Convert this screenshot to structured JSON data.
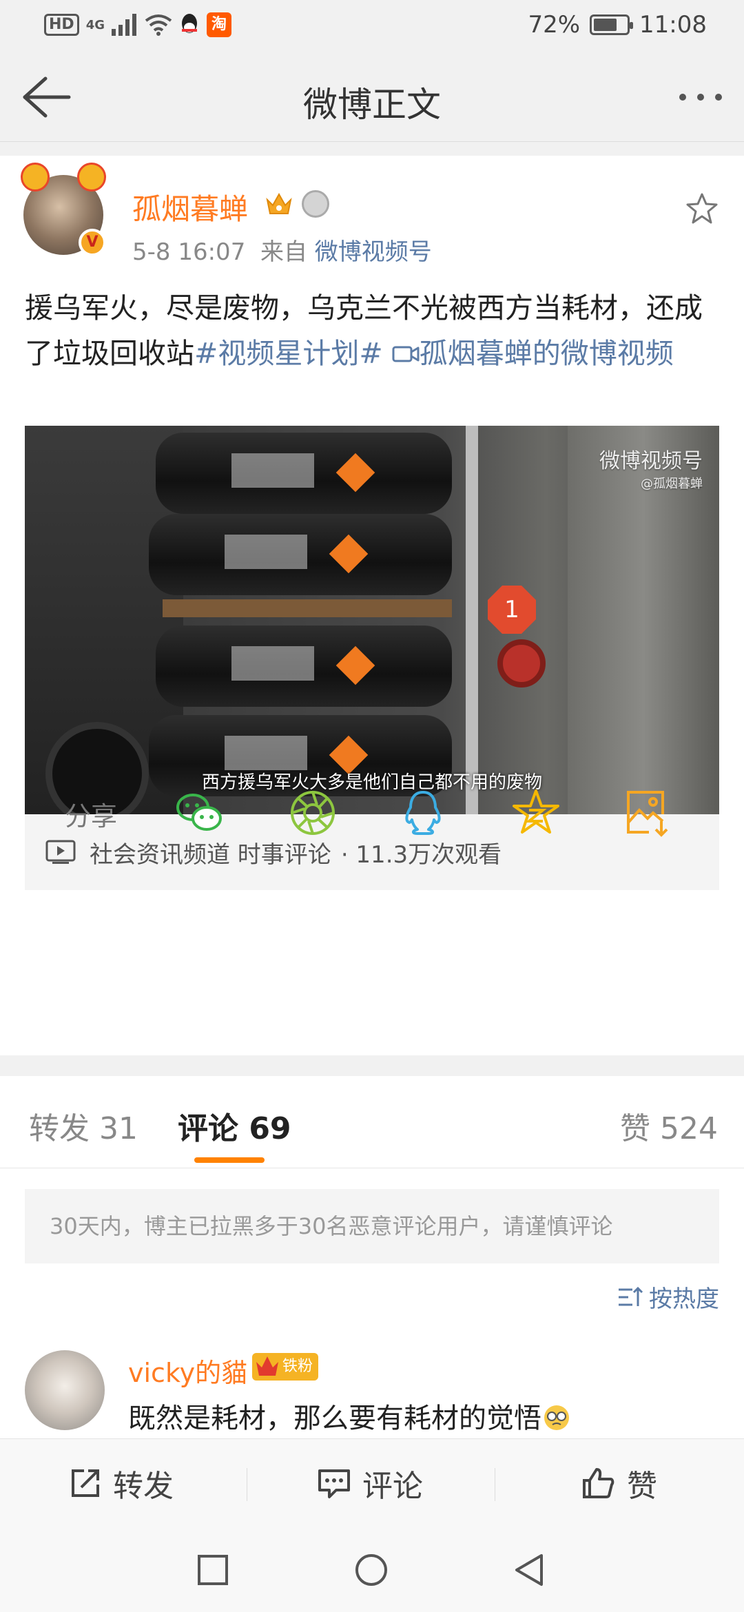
{
  "status_bar": {
    "hd": "HD",
    "network": "4G",
    "taobao": "淘",
    "battery_percent": "72%",
    "battery_level": 0.72,
    "time": "11:08"
  },
  "header": {
    "title": "微博正文"
  },
  "post": {
    "username": "孤烟暮蝉",
    "vip_badge": "V",
    "time": "5-8 16:07",
    "from_label": "来自",
    "source": "微博视频号",
    "text_main": "援乌军火，尽是废物，乌克兰不光被西方当耗材，还成了垃圾回收站",
    "hashtag": "#视频星计划#",
    "video_link": "孤烟暮蝉的微博视频"
  },
  "video": {
    "watermark": "微博视频号",
    "watermark_handle": "@孤烟暮蝉",
    "sign_number": "1",
    "subtitle": "西方援乌军火大多是他们自己都不用的废物",
    "channel": "社会资讯频道 时事评论",
    "views": "· 11.3万次观看"
  },
  "share": {
    "label": "分享"
  },
  "tabs": {
    "repost": "转发 31",
    "comment": "评论 69",
    "like": "赞 524"
  },
  "notice": "30天内，博主已拉黑多于30名恶意评论用户，请谨慎评论",
  "sort": "按热度",
  "comment": {
    "username": "vicky的貓",
    "badge": "铁粉",
    "text": "既然是耗材，那么要有耗材的觉悟"
  },
  "actions": {
    "repost": "转发",
    "comment": "评论",
    "like": "赞"
  }
}
